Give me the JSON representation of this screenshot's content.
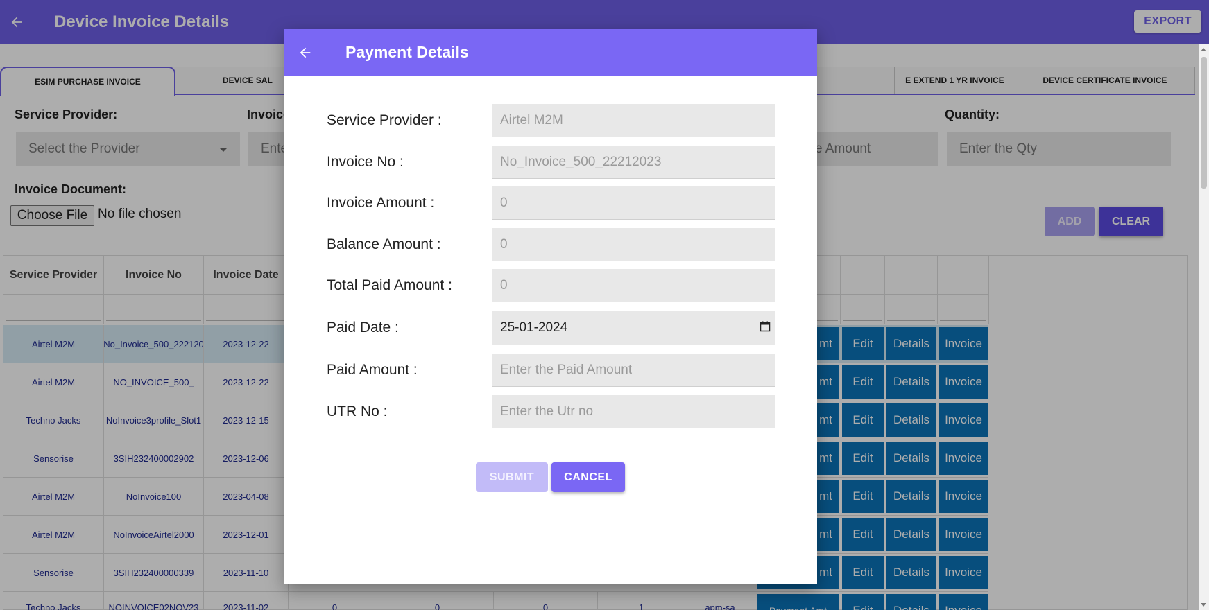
{
  "app": {
    "title": "Device Invoice Details",
    "export_label": "EXPORT"
  },
  "tabs": [
    {
      "label": "ESIM PURCHASE INVOICE",
      "active": true
    },
    {
      "label": "DEVICE SAL",
      "active": false
    },
    {
      "label": "E EXTEND 1 YR INVOICE",
      "active": false
    },
    {
      "label": "DEVICE CERTIFICATE INVOICE",
      "active": false
    }
  ],
  "form": {
    "service_provider_label": "Service Provider:",
    "service_provider_placeholder": "Select the Provider",
    "invoice_label": "Invoice",
    "invoice_placeholder": "Ente",
    "amount_placeholder": "e Amount",
    "quantity_label": "Quantity:",
    "quantity_placeholder": "Enter the Qty",
    "document_label": "Invoice Document:",
    "choose_file": "Choose File",
    "no_file": "No file chosen",
    "add_label": "ADD",
    "clear_label": "CLEAR"
  },
  "table": {
    "headers": [
      "Service Provider",
      "Invoice No",
      "Invoice Date"
    ],
    "rows": [
      {
        "provider": "Airtel M2M",
        "invoice_no": "No_Invoice_500_222120",
        "date": "2023-12-22",
        "selected": true
      },
      {
        "provider": "Airtel M2M",
        "invoice_no": "NO_INVOICE_500_",
        "date": "2023-12-22"
      },
      {
        "provider": "Techno Jacks",
        "invoice_no": "NoInvoice3profile_Slot1",
        "date": "2023-12-15"
      },
      {
        "provider": "Sensorise",
        "invoice_no": "3SIH232400002902",
        "date": "2023-12-06"
      },
      {
        "provider": "Airtel M2M",
        "invoice_no": "NoInvoice100",
        "date": "2023-04-08"
      },
      {
        "provider": "Airtel M2M",
        "invoice_no": "NoInvoiceAirtel2000",
        "date": "2023-12-01"
      },
      {
        "provider": "Sensorise",
        "invoice_no": "3SIH232400000339",
        "date": "2023-11-10"
      },
      {
        "provider": "Techno Jacks",
        "invoice_no": "NOINVOICE02NOV23",
        "date": "2023-11-02",
        "c4": "0",
        "c5": "0",
        "c6": "0",
        "c7": "1",
        "c8": "apm-sa"
      }
    ],
    "actions": {
      "payment_partial": "mt",
      "payment_full": "Payment Amt",
      "edit": "Edit",
      "details": "Details",
      "invoice": "Invoice"
    }
  },
  "dialog": {
    "title": "Payment Details",
    "fields": [
      {
        "label": "Service Provider :",
        "value": "Airtel M2M"
      },
      {
        "label": "Invoice No :",
        "value": "No_Invoice_500_22212023"
      },
      {
        "label": "Invoice Amount :",
        "value": "0"
      },
      {
        "label": "Balance Amount :",
        "value": "0"
      },
      {
        "label": "Total Paid Amount :",
        "value": "0"
      },
      {
        "label": "Paid Date :",
        "value": "25-01-2024"
      },
      {
        "label": "Paid Amount :",
        "placeholder": "Enter the Paid Amount"
      },
      {
        "label": "UTR No :",
        "placeholder": "Enter the Utr no"
      }
    ],
    "submit_label": "SUBMIT",
    "cancel_label": "CANCEL"
  },
  "colors": {
    "primary": "#6e5fe6",
    "dialog_header": "#7a67f4",
    "action_button": "#0b73b8",
    "selected_row": "#d6ebf5"
  }
}
